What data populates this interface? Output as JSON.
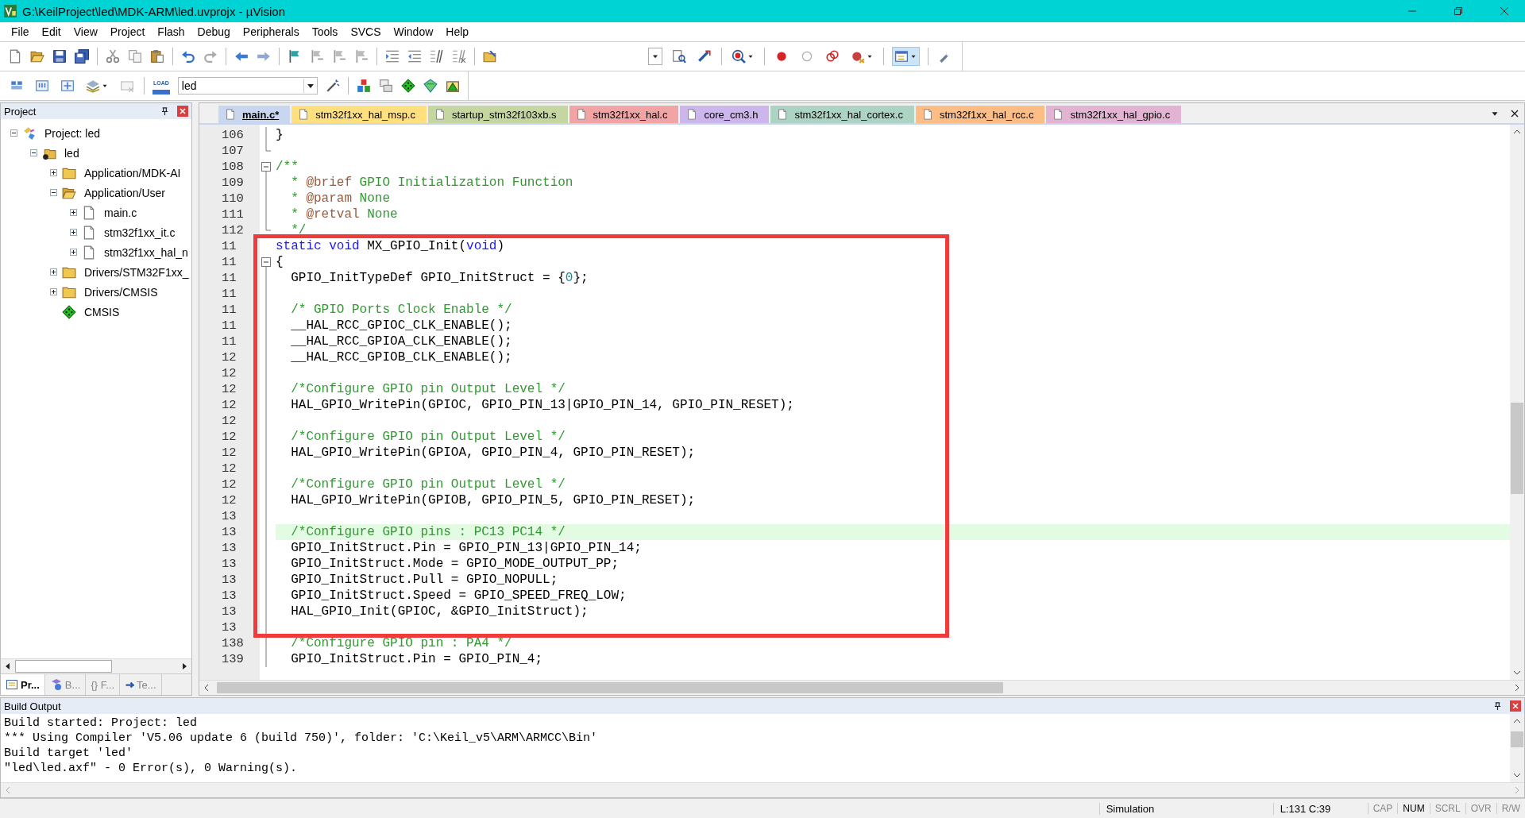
{
  "window": {
    "title": "G:\\KeilProject\\led\\MDK-ARM\\led.uvprojx - µVision"
  },
  "menu": [
    "File",
    "Edit",
    "View",
    "Project",
    "Flash",
    "Debug",
    "Peripherals",
    "Tools",
    "SVCS",
    "Window",
    "Help"
  ],
  "toolbar": {
    "load_label": "LOAD",
    "target": "led"
  },
  "project_panel": {
    "title": "Project",
    "tree": [
      {
        "label": "Project: led",
        "kind": "project",
        "expanded": true,
        "children": [
          {
            "label": "led",
            "kind": "target",
            "expanded": true,
            "children": [
              {
                "label": "Application/MDK-AI",
                "kind": "folder",
                "expanded": false
              },
              {
                "label": "Application/User",
                "kind": "folder",
                "expanded": true,
                "children": [
                  {
                    "label": "main.c",
                    "kind": "file",
                    "expanded": false
                  },
                  {
                    "label": "stm32f1xx_it.c",
                    "kind": "file",
                    "expanded": false
                  },
                  {
                    "label": "stm32f1xx_hal_n",
                    "kind": "file",
                    "expanded": false
                  }
                ]
              },
              {
                "label": "Drivers/STM32F1xx_",
                "kind": "folder",
                "expanded": false
              },
              {
                "label": "Drivers/CMSIS",
                "kind": "folder",
                "expanded": false
              },
              {
                "label": "CMSIS",
                "kind": "component"
              }
            ]
          }
        ]
      }
    ],
    "tabs": [
      {
        "label": "Pr...",
        "kind": "project",
        "selected": true
      },
      {
        "label": "B...",
        "kind": "books",
        "selected": false
      },
      {
        "label": "{} F...",
        "kind": "functions",
        "selected": false
      },
      {
        "label": "Te...",
        "kind": "templates",
        "selected": false
      }
    ]
  },
  "editor": {
    "tabs": [
      {
        "label": "main.c*",
        "color": "#c9d6ef",
        "selected": true
      },
      {
        "label": "stm32f1xx_hal_msp.c",
        "color": "#ffdf7e",
        "selected": false
      },
      {
        "label": "startup_stm32f103xb.s",
        "color": "#c5d6a0",
        "selected": false
      },
      {
        "label": "stm32f1xx_hal.c",
        "color": "#f2a4a4",
        "selected": false
      },
      {
        "label": "core_cm3.h",
        "color": "#cdb6ec",
        "selected": false
      },
      {
        "label": "stm32f1xx_hal_cortex.c",
        "color": "#acd3c3",
        "selected": false
      },
      {
        "label": "stm32f1xx_hal_rcc.c",
        "color": "#fdbd84",
        "selected": false
      },
      {
        "label": "stm32f1xx_hal_gpio.c",
        "color": "#e3b3d3",
        "selected": false
      }
    ],
    "lines": [
      {
        "number": "106",
        "kind": "fold-body",
        "tokens": [
          {
            "kind": "plain",
            "text": "}"
          }
        ]
      },
      {
        "number": "107",
        "kind": "fold-end"
      },
      {
        "number": "108",
        "kind": "fold-start",
        "tokens": [
          {
            "kind": "comment",
            "text": "/**"
          }
        ]
      },
      {
        "number": "109",
        "kind": "fold-body",
        "tokens": [
          {
            "kind": "comment",
            "text": "  * "
          },
          {
            "kind": "doctag",
            "text": "@brief"
          },
          {
            "kind": "comment",
            "text": " GPIO Initialization Function"
          }
        ]
      },
      {
        "number": "110",
        "kind": "fold-body",
        "tokens": [
          {
            "kind": "comment",
            "text": "  * "
          },
          {
            "kind": "doctag",
            "text": "@param"
          },
          {
            "kind": "comment",
            "text": " None"
          }
        ]
      },
      {
        "number": "111",
        "kind": "fold-body",
        "tokens": [
          {
            "kind": "comment",
            "text": "  * "
          },
          {
            "kind": "doctag",
            "text": "@retval"
          },
          {
            "kind": "comment",
            "text": " None"
          }
        ]
      },
      {
        "number": "112",
        "kind": "fold-end",
        "tokens": [
          {
            "kind": "comment",
            "text": "  */"
          }
        ]
      },
      {
        "number": "11",
        "kind": "plain",
        "tokens": [
          {
            "kind": "keyword",
            "text": "static void"
          },
          {
            "kind": "plain",
            "text": " MX_GPIO_Init("
          },
          {
            "kind": "keyword",
            "text": "void"
          },
          {
            "kind": "plain",
            "text": ")"
          }
        ]
      },
      {
        "number": "11",
        "kind": "fold-start",
        "tokens": [
          {
            "kind": "plain",
            "text": "{"
          }
        ]
      },
      {
        "number": "11",
        "kind": "fold-body",
        "tokens": [
          {
            "kind": "plain",
            "text": "  GPIO_InitTypeDef GPIO_InitStruct = {"
          },
          {
            "kind": "number",
            "text": "0"
          },
          {
            "kind": "plain",
            "text": "};"
          }
        ]
      },
      {
        "number": "11",
        "kind": "fold-body"
      },
      {
        "number": "11",
        "kind": "fold-body",
        "tokens": [
          {
            "kind": "comment",
            "text": "  /* GPIO Ports Clock Enable */"
          }
        ]
      },
      {
        "number": "11",
        "kind": "fold-body",
        "tokens": [
          {
            "kind": "plain",
            "text": "  __HAL_RCC_GPIOC_CLK_ENABLE();"
          }
        ]
      },
      {
        "number": "11",
        "kind": "fold-body",
        "tokens": [
          {
            "kind": "plain",
            "text": "  __HAL_RCC_GPIOA_CLK_ENABLE();"
          }
        ]
      },
      {
        "number": "12",
        "kind": "fold-body",
        "tokens": [
          {
            "kind": "plain",
            "text": "  __HAL_RCC_GPIOB_CLK_ENABLE();"
          }
        ]
      },
      {
        "number": "12",
        "kind": "fold-body"
      },
      {
        "number": "12",
        "kind": "fold-body",
        "tokens": [
          {
            "kind": "comment",
            "text": "  /*Configure GPIO pin Output Level */"
          }
        ]
      },
      {
        "number": "12",
        "kind": "fold-body",
        "tokens": [
          {
            "kind": "plain",
            "text": "  HAL_GPIO_WritePin(GPIOC, GPIO_PIN_13|GPIO_PIN_14, GPIO_PIN_RESET);"
          }
        ]
      },
      {
        "number": "12",
        "kind": "fold-body"
      },
      {
        "number": "12",
        "kind": "fold-body",
        "tokens": [
          {
            "kind": "comment",
            "text": "  /*Configure GPIO pin Output Level */"
          }
        ]
      },
      {
        "number": "12",
        "kind": "fold-body",
        "tokens": [
          {
            "kind": "plain",
            "text": "  HAL_GPIO_WritePin(GPIOA, GPIO_PIN_4, GPIO_PIN_RESET);"
          }
        ]
      },
      {
        "number": "12",
        "kind": "fold-body"
      },
      {
        "number": "12",
        "kind": "fold-body",
        "tokens": [
          {
            "kind": "comment",
            "text": "  /*Configure GPIO pin Output Level */"
          }
        ]
      },
      {
        "number": "12",
        "kind": "fold-body",
        "tokens": [
          {
            "kind": "plain",
            "text": "  HAL_GPIO_WritePin(GPIOB, GPIO_PIN_5, GPIO_PIN_RESET);"
          }
        ]
      },
      {
        "number": "13",
        "kind": "fold-body"
      },
      {
        "number": "13",
        "kind": "fold-body",
        "current": true,
        "tokens": [
          {
            "kind": "comment",
            "text": "  /*Configure GPIO pins : PC13 PC14 */"
          }
        ]
      },
      {
        "number": "13",
        "kind": "fold-body",
        "tokens": [
          {
            "kind": "plain",
            "text": "  GPIO_InitStruct.Pin = GPIO_PIN_13|GPIO_PIN_14;"
          }
        ]
      },
      {
        "number": "13",
        "kind": "fold-body",
        "tokens": [
          {
            "kind": "plain",
            "text": "  GPIO_InitStruct.Mode = GPIO_MODE_OUTPUT_PP;"
          }
        ]
      },
      {
        "number": "13",
        "kind": "fold-body",
        "tokens": [
          {
            "kind": "plain",
            "text": "  GPIO_InitStruct.Pull = GPIO_NOPULL;"
          }
        ]
      },
      {
        "number": "13",
        "kind": "fold-body",
        "tokens": [
          {
            "kind": "plain",
            "text": "  GPIO_InitStruct.Speed = GPIO_SPEED_FREQ_LOW;"
          }
        ]
      },
      {
        "number": "13",
        "kind": "fold-body",
        "tokens": [
          {
            "kind": "plain",
            "text": "  HAL_GPIO_Init(GPIOC, &GPIO_InitStruct);"
          }
        ]
      },
      {
        "number": "13",
        "kind": "fold-body"
      },
      {
        "number": "138",
        "kind": "fold-body",
        "tokens": [
          {
            "kind": "comment",
            "text": "  /*Configure GPIO pin : PA4 */"
          }
        ]
      },
      {
        "number": "139",
        "kind": "fold-body",
        "tokens": [
          {
            "kind": "plain",
            "text": "  GPIO_InitStruct.Pin = GPIO_PIN_4;"
          }
        ]
      }
    ]
  },
  "build_output": {
    "title": "Build Output",
    "lines": [
      "Build started: Project: led",
      "*** Using Compiler 'V5.06 update 6 (build 750)', folder: 'C:\\Keil_v5\\ARM\\ARMCC\\Bin'",
      "Build target 'led'",
      "\"led\\led.axf\" - 0 Error(s), 0 Warning(s)."
    ]
  },
  "status_bar": {
    "mode": "Simulation",
    "position": "L:131 C:39",
    "indicators": [
      {
        "label": "CAP",
        "on": false
      },
      {
        "label": "NUM",
        "on": true
      },
      {
        "label": "SCRL",
        "on": false
      },
      {
        "label": "OVR",
        "on": false
      },
      {
        "label": "R/W",
        "on": false
      }
    ]
  }
}
